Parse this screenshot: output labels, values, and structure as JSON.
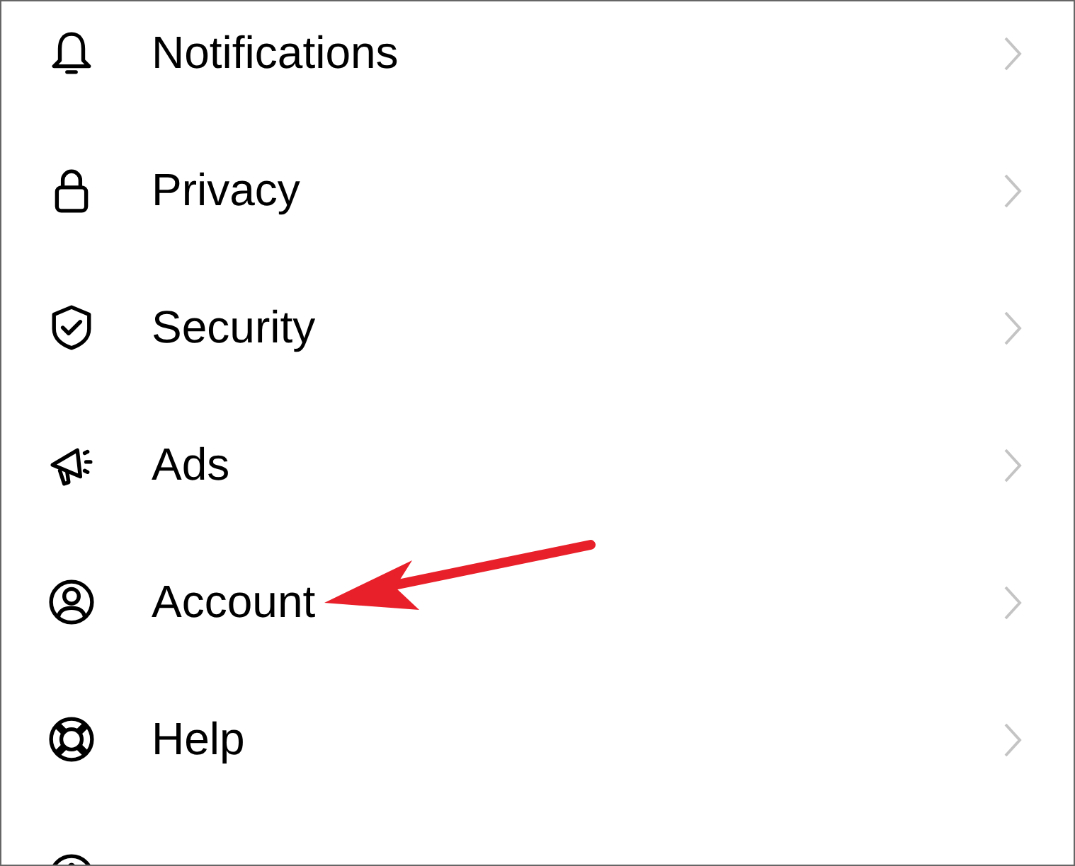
{
  "settings_menu": {
    "items": [
      {
        "label": "Notifications"
      },
      {
        "label": "Privacy"
      },
      {
        "label": "Security"
      },
      {
        "label": "Ads"
      },
      {
        "label": "Account"
      },
      {
        "label": "Help"
      }
    ]
  }
}
